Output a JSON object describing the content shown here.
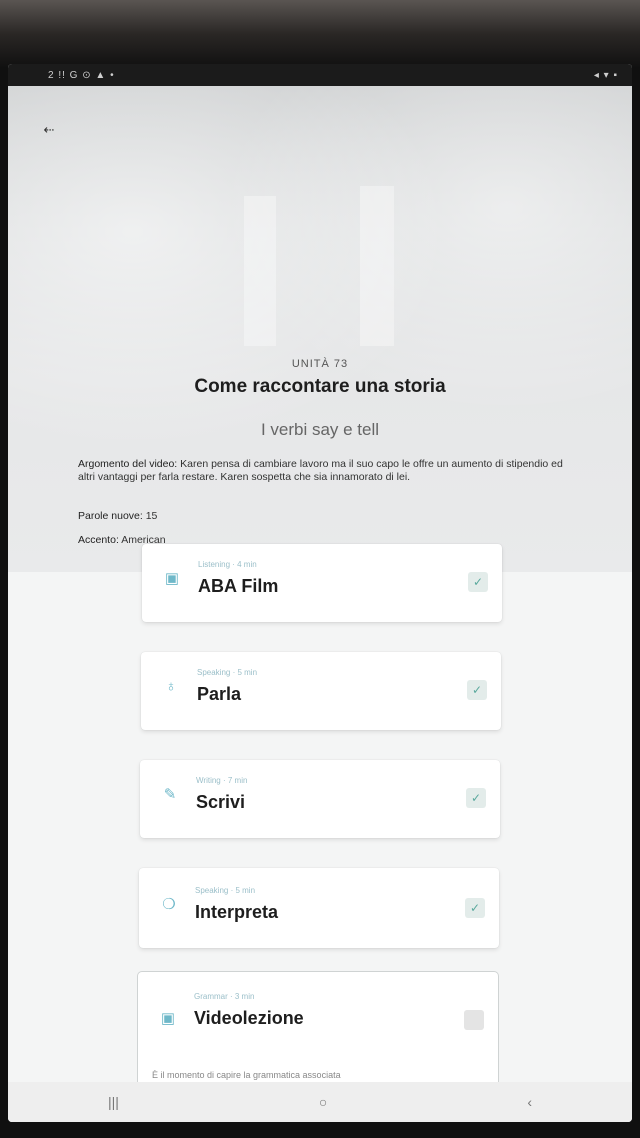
{
  "status_bar": {
    "left": "2 !! G ⊙ ▲ •",
    "right": "◂ ▾ ▪"
  },
  "header": {
    "back_icon": "arrow-left-icon",
    "back_glyph": "⇠"
  },
  "unit": {
    "label": "UNITÀ 73",
    "title": "Come raccontare una storia",
    "subtitle": "I verbi say e tell"
  },
  "details": {
    "topic_label": "Argomento del video:",
    "topic_text": "Karen pensa di cambiare lavoro ma il suo capo le offre un aumento di stipendio ed altri vantaggi per farla restare. Karen sospetta che sia innamorato di lei.",
    "words_label": "Parole nuove:",
    "words_value": "15",
    "accent_label": "Accento:",
    "accent_value": "American"
  },
  "activities": [
    {
      "meta": "Listening · 4 min",
      "title": "ABA Film",
      "icon": "film-icon",
      "glyph": "▣",
      "status": "completed",
      "check": "✓"
    },
    {
      "meta": "Speaking · 5 min",
      "title": "Parla",
      "icon": "microphone-icon",
      "glyph": "♁",
      "status": "completed",
      "check": "✓"
    },
    {
      "meta": "Writing · 7 min",
      "title": "Scrivi",
      "icon": "pen-icon",
      "glyph": "✎",
      "status": "completed",
      "check": "✓"
    },
    {
      "meta": "Speaking · 5 min",
      "title": "Interpreta",
      "icon": "chat-bubbles-icon",
      "glyph": "❍",
      "status": "completed",
      "check": "✓"
    },
    {
      "meta": "Grammar · 3 min",
      "title": "Videolezione",
      "icon": "video-lesson-icon",
      "glyph": "▣",
      "status": "pending",
      "desc": "È il momento di capire la grammatica associata"
    }
  ],
  "navbar": {
    "recents": "|||",
    "home": "○",
    "back": "‹"
  },
  "colors": {
    "accent": "#6fb8c9",
    "check": "#5aa99d"
  }
}
